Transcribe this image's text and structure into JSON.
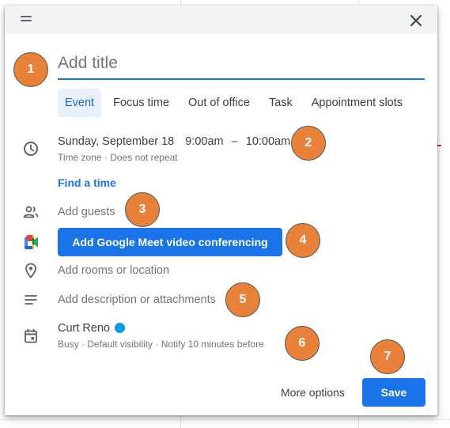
{
  "dialog": {
    "title_placeholder": "Add title",
    "tabs": [
      {
        "label": "Event",
        "active": true
      },
      {
        "label": "Focus time",
        "active": false
      },
      {
        "label": "Out of office",
        "active": false
      },
      {
        "label": "Task",
        "active": false
      },
      {
        "label": "Appointment slots",
        "active": false
      }
    ],
    "datetime": {
      "date": "Sunday, September 18",
      "start": "9:00am",
      "dash": "–",
      "end": "10:00am",
      "subtext": "Time zone · Does not repeat"
    },
    "find_time": "Find a time",
    "add_guests": "Add guests",
    "meet_button": "Add Google Meet video conferencing",
    "add_location": "Add rooms or location",
    "add_description": "Add description or attachments",
    "calendar": {
      "owner": "Curt Reno",
      "color": "#039be5",
      "subtext": "Busy · Default visibility · Notify 10 minutes before"
    },
    "more_options": "More options",
    "save": "Save"
  },
  "callouts": [
    "1",
    "2",
    "3",
    "4",
    "5",
    "6",
    "7"
  ],
  "colors": {
    "accent": "#1a73e8",
    "callout": "#e8823a",
    "tab_active_bg": "#e8f0fe"
  }
}
